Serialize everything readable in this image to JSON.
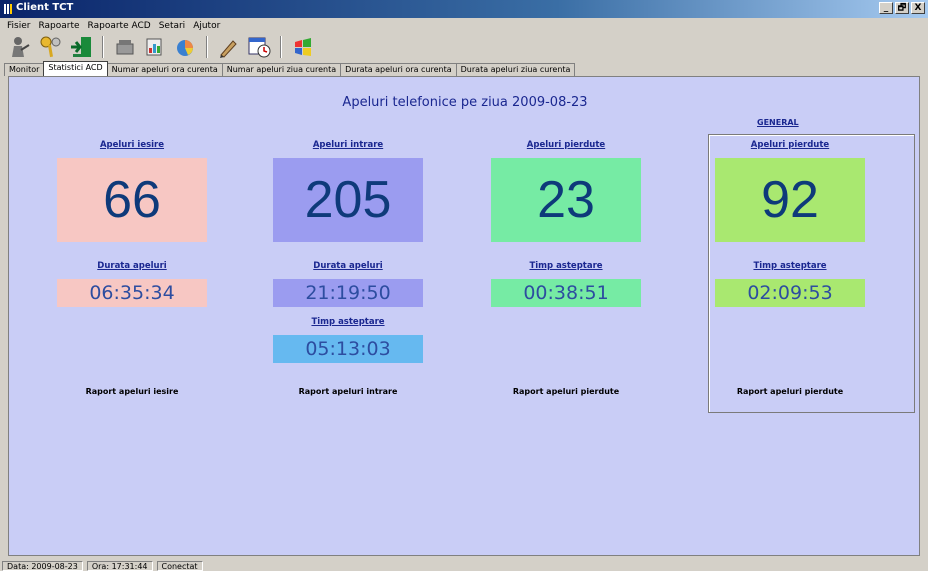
{
  "window": {
    "title": "Client TCT",
    "buttons": [
      "_",
      "🗗",
      "X"
    ]
  },
  "menu": [
    "Fisier",
    "Rapoarte",
    "Rapoarte ACD",
    "Setari",
    "Ajutor"
  ],
  "tabs": [
    {
      "label": "Monitor",
      "active": false
    },
    {
      "label": "Statistici ACD",
      "active": true
    },
    {
      "label": "Numar apeluri ora curenta",
      "active": false
    },
    {
      "label": "Numar apeluri ziua curenta",
      "active": false
    },
    {
      "label": "Durata apeluri ora curenta",
      "active": false
    },
    {
      "label": "Durata apeluri ziua curenta",
      "active": false
    }
  ],
  "main": {
    "title": "Apeluri telefonice pe ziua 2009-08-23",
    "general_label": "GENERAL",
    "columns": [
      {
        "header": "Apeluri iesire",
        "count": "66",
        "duration_label": "Durata apeluri",
        "duration": "06:35:34",
        "wait_label": "",
        "wait": "",
        "report": "Raport apeluri iesire",
        "count_color": "#f7c7c3",
        "time_color": "#f7c7c3"
      },
      {
        "header": "Apeluri intrare",
        "count": "205",
        "duration_label": "Durata apeluri",
        "duration": "21:19:50",
        "wait_label": "Timp asteptare",
        "wait": "05:13:03",
        "report": "Raport apeluri intrare",
        "count_color": "#9b9cf0",
        "time_color": "#9b9cf0",
        "wait_color": "#66b9f0"
      },
      {
        "header": "Apeluri pierdute",
        "count": "23",
        "duration_label": "Timp asteptare",
        "duration": "00:38:51",
        "wait_label": "",
        "wait": "",
        "report": "Raport apeluri pierdute",
        "count_color": "#76eba4",
        "time_color": "#76eba4"
      },
      {
        "header": "Apeluri pierdute",
        "count": "92",
        "duration_label": "Timp asteptare",
        "duration": "02:09:53",
        "wait_label": "",
        "wait": "",
        "report": "Raport apeluri pierdute",
        "count_color": "#a9e870",
        "time_color": "#a9e870"
      }
    ]
  },
  "status": {
    "date": "Data: 2009-08-23",
    "time": "Ora: 17:31:44",
    "state": "Conectat"
  }
}
